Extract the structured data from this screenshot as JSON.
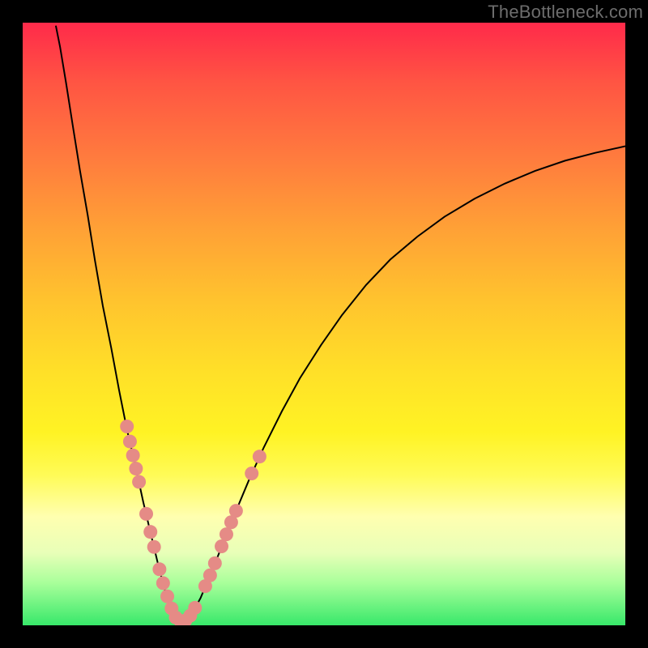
{
  "watermark": "TheBottleneck.com",
  "colors": {
    "frame": "#000000",
    "curve": "#000000",
    "marker_fill": "#e58b86",
    "marker_stroke": "#d07f7a"
  },
  "chart_data": {
    "type": "line",
    "title": "",
    "xlabel": "",
    "ylabel": "",
    "xlim": [
      0,
      100
    ],
    "ylim": [
      0,
      100
    ],
    "grid": false,
    "legend": false,
    "description": "Estimated bottleneck curve: a sharp V-shaped function dropping from ~100 at x=0 to ~0 at x≈25 then rising, concave-down, toward ~80 at x=100. Pink circular markers are clustered along both sides of the V near the bottom.",
    "curve_points": [
      {
        "x": 5.5,
        "y": 99.5
      },
      {
        "x": 6.2,
        "y": 96.0
      },
      {
        "x": 7.2,
        "y": 90.0
      },
      {
        "x": 8.3,
        "y": 83.0
      },
      {
        "x": 9.5,
        "y": 75.5
      },
      {
        "x": 10.8,
        "y": 68.0
      },
      {
        "x": 12.0,
        "y": 60.5
      },
      {
        "x": 13.3,
        "y": 53.0
      },
      {
        "x": 14.7,
        "y": 46.0
      },
      {
        "x": 16.0,
        "y": 39.0
      },
      {
        "x": 17.3,
        "y": 32.5
      },
      {
        "x": 18.7,
        "y": 26.5
      },
      {
        "x": 20.0,
        "y": 20.5
      },
      {
        "x": 21.3,
        "y": 15.0
      },
      {
        "x": 22.5,
        "y": 10.0
      },
      {
        "x": 23.7,
        "y": 5.5
      },
      {
        "x": 24.8,
        "y": 2.3
      },
      {
        "x": 25.8,
        "y": 0.7
      },
      {
        "x": 26.8,
        "y": 0.6
      },
      {
        "x": 28.0,
        "y": 1.8
      },
      {
        "x": 29.5,
        "y": 4.5
      },
      {
        "x": 31.2,
        "y": 8.5
      },
      {
        "x": 33.0,
        "y": 13.0
      },
      {
        "x": 35.2,
        "y": 18.5
      },
      {
        "x": 37.5,
        "y": 24.0
      },
      {
        "x": 40.0,
        "y": 29.5
      },
      {
        "x": 43.0,
        "y": 35.5
      },
      {
        "x": 46.0,
        "y": 41.0
      },
      {
        "x": 49.5,
        "y": 46.5
      },
      {
        "x": 53.0,
        "y": 51.5
      },
      {
        "x": 57.0,
        "y": 56.5
      },
      {
        "x": 61.0,
        "y": 60.7
      },
      {
        "x": 65.5,
        "y": 64.5
      },
      {
        "x": 70.0,
        "y": 67.8
      },
      {
        "x": 75.0,
        "y": 70.8
      },
      {
        "x": 80.0,
        "y": 73.3
      },
      {
        "x": 85.0,
        "y": 75.4
      },
      {
        "x": 90.0,
        "y": 77.1
      },
      {
        "x": 95.0,
        "y": 78.4
      },
      {
        "x": 100.0,
        "y": 79.5
      }
    ],
    "markers": [
      {
        "x": 17.3,
        "y": 33.0
      },
      {
        "x": 17.8,
        "y": 30.5
      },
      {
        "x": 18.3,
        "y": 28.2
      },
      {
        "x": 18.8,
        "y": 26.0
      },
      {
        "x": 19.3,
        "y": 23.8
      },
      {
        "x": 20.5,
        "y": 18.5
      },
      {
        "x": 21.2,
        "y": 15.5
      },
      {
        "x": 21.8,
        "y": 13.0
      },
      {
        "x": 22.7,
        "y": 9.3
      },
      {
        "x": 23.3,
        "y": 7.0
      },
      {
        "x": 24.0,
        "y": 4.8
      },
      {
        "x": 24.7,
        "y": 2.8
      },
      {
        "x": 25.4,
        "y": 1.3
      },
      {
        "x": 26.2,
        "y": 0.7
      },
      {
        "x": 27.0,
        "y": 0.8
      },
      {
        "x": 27.8,
        "y": 1.6
      },
      {
        "x": 28.6,
        "y": 2.9
      },
      {
        "x": 30.3,
        "y": 6.5
      },
      {
        "x": 31.1,
        "y": 8.3
      },
      {
        "x": 31.9,
        "y": 10.3
      },
      {
        "x": 33.0,
        "y": 13.1
      },
      {
        "x": 33.8,
        "y": 15.1
      },
      {
        "x": 34.6,
        "y": 17.1
      },
      {
        "x": 35.4,
        "y": 19.0
      },
      {
        "x": 38.0,
        "y": 25.2
      },
      {
        "x": 39.3,
        "y": 28.0
      }
    ]
  }
}
